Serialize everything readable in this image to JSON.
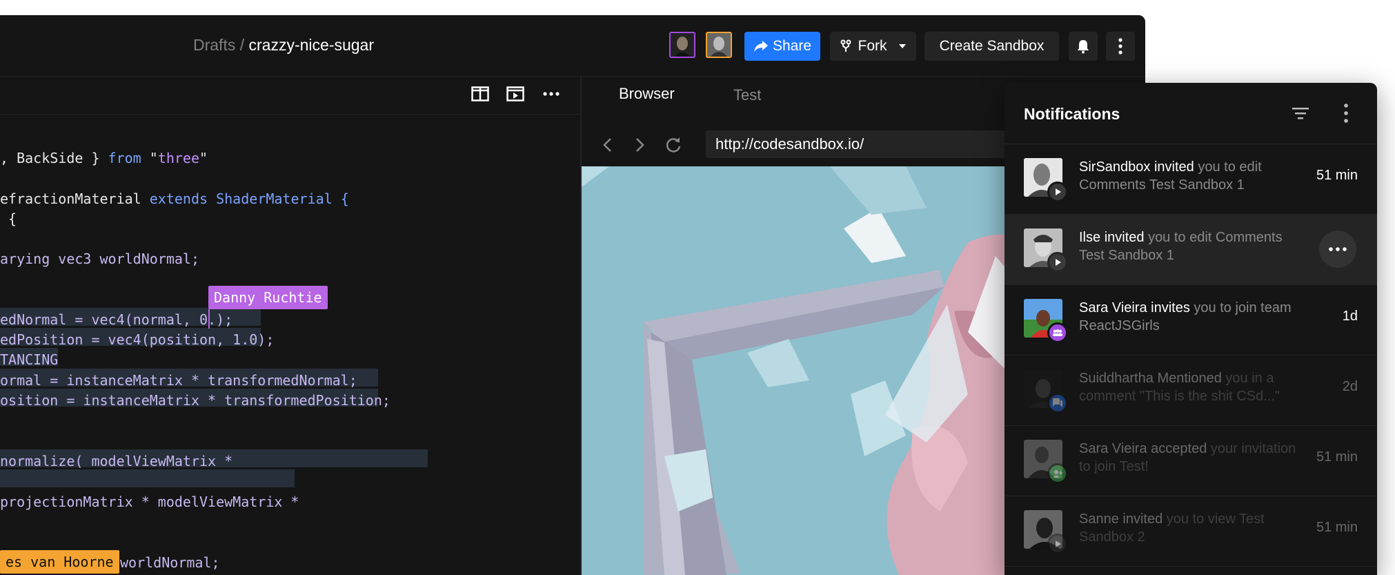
{
  "header": {
    "breadcrumb_parent": "Drafts",
    "breadcrumb_sep": " / ",
    "sandbox_name": "crazzy-nice-sugar",
    "share_label": "Share",
    "fork_label": "Fork",
    "create_label": "Create Sandbox"
  },
  "code": {
    "lines": [
      ", BackSide } from \"three\"",
      "efractionMaterial extends ShaderMaterial {",
      " {",
      "arying vec3 worldNormal;",
      "edNormal = vec4(normal, 0.);",
      "edPosition = vec4(position, 1.0);",
      "TANCING",
      "ormal = instanceMatrix * transformedNormal;",
      "osition = instanceMatrix * transformedPosition;",
      "normalize( modelViewMatrix *",
      "",
      "projectionMatrix * modelViewMatrix *",
      "worldNormal;"
    ],
    "cursor_danny": "Danny Ruchtie",
    "cursor_other": "es van Hoorne"
  },
  "preview": {
    "tab_browser": "Browser",
    "tab_test": "Test",
    "url": "http://codesandbox.io/"
  },
  "notifications": {
    "title": "Notifications",
    "items": [
      {
        "actor": "SirSandbox",
        "verb": "invited",
        "rest": "you to edit Comments Test Sandbox 1",
        "time": "51 min",
        "badge_color": "#3a3a3a"
      },
      {
        "actor": "Ilse",
        "verb": "invited",
        "rest": "you to edit Comments Test Sandbox 1",
        "time": "",
        "badge_color": "#3a3a3a"
      },
      {
        "actor": "Sara Vieira",
        "verb": "invites",
        "rest": "you to join team ReactJSGirls",
        "time": "1d",
        "badge_color": "#a24ce0"
      },
      {
        "actor": "Suiddhartha",
        "verb": "Mentioned",
        "rest": "you in a comment \"This is the shit CSd...\"",
        "time": "2d",
        "badge_color": "#1f6fe5"
      },
      {
        "actor": "Sara Vieira",
        "verb": "accepted",
        "rest": "your invitation to join Test!",
        "time": "51 min",
        "badge_color": "#3fb950"
      },
      {
        "actor": "Sanne",
        "verb": "invited",
        "rest": "you to view Test Sandbox 2",
        "time": "51 min",
        "badge_color": "#3a3a3a"
      }
    ]
  },
  "colors": {
    "accent_blue": "#1f79ff",
    "cursor_purple": "#b865e6",
    "cursor_orange": "#f5a431",
    "preview_bg": "#8dbfcc"
  }
}
